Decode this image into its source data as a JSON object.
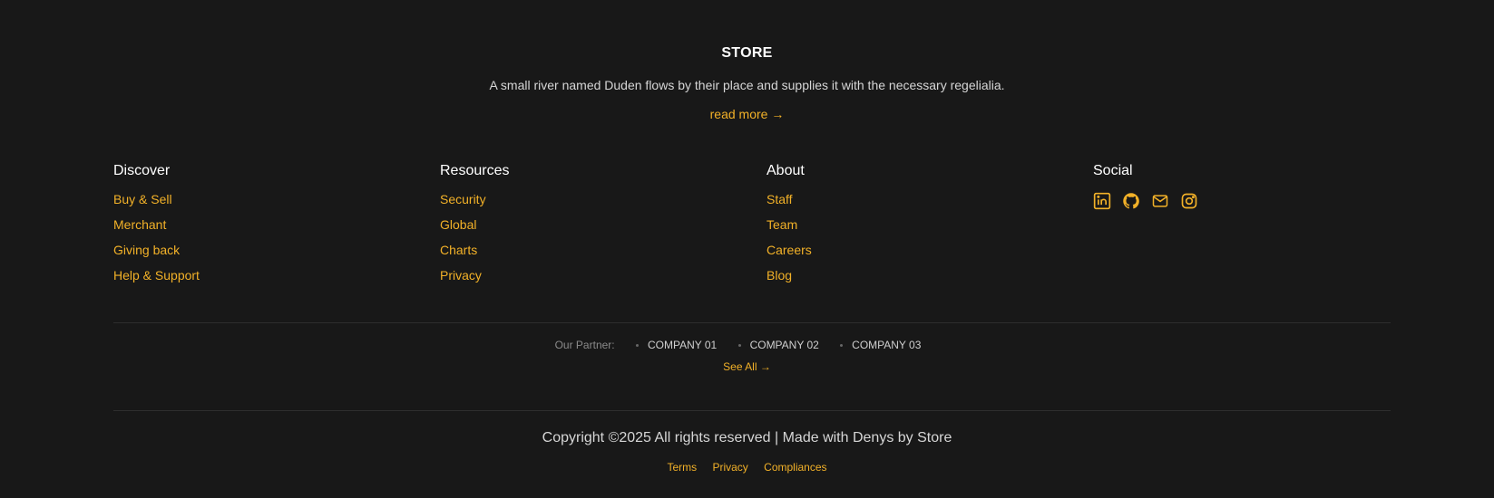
{
  "brand": {
    "title": "STORE",
    "tagline": "A small river named Duden flows by their place and supplies it with the necessary regelialia.",
    "read_more": "read more →"
  },
  "columns": [
    {
      "heading": "Discover",
      "links": [
        "Buy & Sell",
        "Merchant",
        "Giving back",
        "Help & Support"
      ]
    },
    {
      "heading": "Resources",
      "links": [
        "Security",
        "Global",
        "Charts",
        "Privacy"
      ]
    },
    {
      "heading": "About",
      "links": [
        "Staff",
        "Team",
        "Careers",
        "Blog"
      ]
    }
  ],
  "social": {
    "heading": "Social",
    "icons": [
      "linkedin-icon",
      "github-icon",
      "mail-icon",
      "instagram-icon"
    ]
  },
  "partners": {
    "label": "Our Partner:",
    "companies": [
      "COMPANY 01",
      "COMPANY 02",
      "COMPANY 03"
    ],
    "see_all": "See All →"
  },
  "bottom": {
    "copyright": "Copyright ©2025 All rights reserved | Made with Denys by Store",
    "links": [
      "Terms",
      "Privacy",
      "Compliances"
    ]
  },
  "colors": {
    "background": "#181818",
    "accent": "#f2b128",
    "text": "#d6d6d6"
  }
}
